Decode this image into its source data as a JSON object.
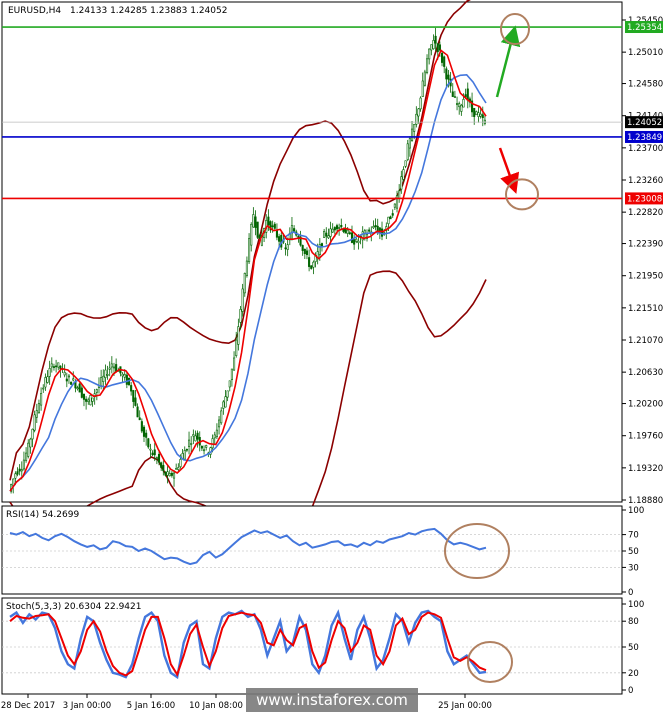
{
  "chart_data": [
    {
      "type": "candlestick",
      "symbol": "EURUSD,H4",
      "ohlc_readout": "1.24133 1.24285 1.23883 1.24052",
      "y_ticks": [
        "1.25450",
        "1.25010",
        "1.24580",
        "1.24140",
        "1.23700",
        "1.23260",
        "1.22820",
        "1.22390",
        "1.21950",
        "1.21510",
        "1.21070",
        "1.20630",
        "1.20200",
        "1.19760",
        "1.19320",
        "1.18880"
      ],
      "y_tick_values": [
        1.2545,
        1.2501,
        1.2458,
        1.2414,
        1.237,
        1.2326,
        1.2282,
        1.2239,
        1.2195,
        1.2151,
        1.2107,
        1.2063,
        1.202,
        1.1976,
        1.1932,
        1.1888
      ],
      "ylim": [
        1.1888,
        1.2545
      ],
      "current_price": {
        "label": "1.24052",
        "value": 1.24052
      },
      "levels": [
        {
          "label": "1.25354",
          "value": 1.25354,
          "color": "#22aa22"
        },
        {
          "label": "1.23849",
          "value": 1.23849,
          "color": "#0000cc"
        },
        {
          "label": "1.23008",
          "value": 1.23008,
          "color": "#ee0000"
        }
      ],
      "close_path": [
        1.19,
        1.1925,
        1.1935,
        1.196,
        1.2,
        1.2035,
        1.206,
        1.2075,
        1.2068,
        1.2055,
        1.205,
        1.204,
        1.202,
        1.203,
        1.2045,
        1.206,
        1.2075,
        1.2065,
        1.2055,
        1.204,
        1.2005,
        1.1975,
        1.1955,
        1.1945,
        1.1925,
        1.192,
        1.193,
        1.195,
        1.1968,
        1.1978,
        1.1962,
        1.1955,
        1.1975,
        1.201,
        1.204,
        1.208,
        1.215,
        1.222,
        1.228,
        1.224,
        1.227,
        1.226,
        1.2245,
        1.223,
        1.226,
        1.225,
        1.2225,
        1.2205,
        1.2225,
        1.225,
        1.2255,
        1.2265,
        1.226,
        1.2248,
        1.224,
        1.225,
        1.2255,
        1.2262,
        1.225,
        1.227,
        1.229,
        1.233,
        1.237,
        1.24,
        1.244,
        1.249,
        1.252,
        1.25,
        1.247,
        1.244,
        1.2425,
        1.2445,
        1.242,
        1.2415,
        1.2405
      ],
      "colors": {
        "candle": "#006400",
        "ma_fast": "#ee0000",
        "ma_slow": "#4477dd",
        "bands": "#8b0000",
        "arrow_up": "#22aa22",
        "arrow_down": "#ee0000",
        "circle": "#b08060"
      }
    },
    {
      "type": "line",
      "label": "RSI(14) 54.2699",
      "y_ticks": [
        "100",
        "70",
        "50",
        "30",
        "0"
      ],
      "y_tick_values": [
        100,
        70,
        50,
        30,
        0
      ],
      "ylim": [
        0,
        100
      ],
      "series": [
        {
          "values": [
            72,
            70,
            73,
            68,
            71,
            66,
            63,
            68,
            71,
            67,
            62,
            58,
            55,
            57,
            52,
            54,
            62,
            60,
            56,
            55,
            50,
            53,
            50,
            45,
            40,
            42,
            41,
            37,
            34,
            36,
            45,
            49,
            42,
            46,
            53,
            60,
            67,
            71,
            75,
            72,
            74,
            70,
            66,
            69,
            62,
            57,
            60,
            54,
            56,
            58,
            61,
            62,
            57,
            58,
            55,
            60,
            57,
            62,
            60,
            64,
            66,
            68,
            72,
            70,
            74,
            76,
            77,
            71,
            63,
            58,
            60,
            58,
            55,
            52,
            54
          ]
        }
      ]
    },
    {
      "type": "line",
      "label": "Stoch(5,3,3) 20.6304 22.9421",
      "y_ticks": [
        "100",
        "80",
        "50",
        "20",
        "0"
      ],
      "y_tick_values": [
        100,
        80,
        50,
        20,
        0
      ],
      "ylim": [
        0,
        100
      ],
      "series": [
        {
          "values": [
            85,
            90,
            78,
            88,
            82,
            90,
            88,
            72,
            45,
            30,
            25,
            60,
            85,
            80,
            55,
            35,
            20,
            18,
            15,
            30,
            60,
            85,
            90,
            80,
            40,
            20,
            15,
            55,
            75,
            80,
            30,
            25,
            60,
            85,
            90,
            88,
            92,
            85,
            88,
            70,
            40,
            60,
            80,
            45,
            55,
            85,
            70,
            30,
            20,
            40,
            75,
            90,
            60,
            35,
            70,
            85,
            60,
            25,
            35,
            60,
            88,
            80,
            55,
            78,
            90,
            92,
            85,
            80,
            45,
            30,
            35,
            40,
            30,
            20,
            21
          ]
        },
        {
          "values": [
            80,
            86,
            84,
            83,
            86,
            87,
            88,
            80,
            60,
            40,
            30,
            45,
            70,
            80,
            68,
            45,
            28,
            20,
            17,
            22,
            45,
            70,
            85,
            85,
            60,
            30,
            18,
            40,
            65,
            76,
            50,
            28,
            45,
            72,
            86,
            88,
            90,
            88,
            87,
            78,
            55,
            52,
            70,
            58,
            52,
            72,
            76,
            45,
            26,
            32,
            58,
            80,
            72,
            45,
            55,
            75,
            70,
            40,
            30,
            45,
            75,
            83,
            65,
            70,
            85,
            90,
            88,
            84,
            60,
            38,
            34,
            38,
            33,
            26,
            23
          ]
        }
      ]
    }
  ],
  "x_ticks": [
    "28 Dec 2017",
    "3 Jan 00:00",
    "5 Jan 16:00",
    "10 Jan 08:00",
    "25 Jan 00:00"
  ],
  "watermark": "www.instaforex.com"
}
